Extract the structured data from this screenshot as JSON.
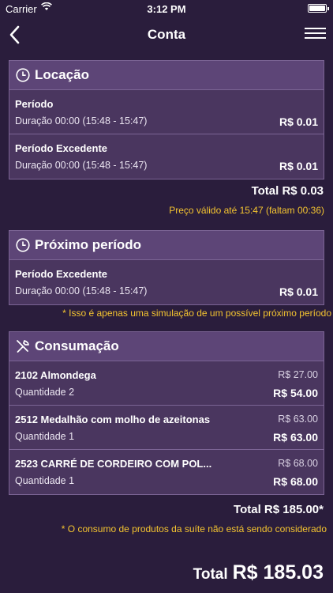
{
  "status": {
    "carrier": "Carrier",
    "time": "3:12 PM"
  },
  "nav": {
    "title": "Conta"
  },
  "locacao": {
    "title": "Locação",
    "rows": [
      {
        "name": "Período",
        "desc": "Duração 00:00 (15:48 - 15:47)",
        "price": "R$ 0.01"
      },
      {
        "name": "Período Excedente",
        "desc": "Duração 00:00 (15:48 - 15:47)",
        "price": "R$ 0.01"
      }
    ],
    "total": "Total R$ 0.03",
    "note": "Preço válido até 15:47 (faltam 00:36)"
  },
  "proximo": {
    "title": "Próximo período",
    "rows": [
      {
        "name": "Período Excedente",
        "desc": "Duração 00:00 (15:48 - 15:47)",
        "price": "R$ 0.01"
      }
    ],
    "note": "* Isso é apenas uma simulação de um possível próximo período"
  },
  "consumacao": {
    "title": "Consumação",
    "rows": [
      {
        "name": "2102 Almondega",
        "unit": "R$ 27.00",
        "desc": "Quantidade 2",
        "price": "R$ 54.00"
      },
      {
        "name": "2512 Medalhão com molho de azeitonas",
        "unit": "R$ 63.00",
        "desc": "Quantidade 1",
        "price": "R$ 63.00"
      },
      {
        "name": "2523 CARRÉ DE CORDEIRO COM POL...",
        "unit": "R$ 68.00",
        "desc": "Quantidade 1",
        "price": "R$ 68.00"
      }
    ],
    "total": "Total R$ 185.00*",
    "note": "* O consumo de produtos da suíte não está sendo considerado"
  },
  "grand": {
    "label": "Total",
    "value": "R$ 185.03"
  },
  "icons": {
    "clock": "clock-icon",
    "cutlery": "cutlery-icon",
    "back": "chevron-left-icon",
    "menu": "hamburger-menu-icon"
  }
}
